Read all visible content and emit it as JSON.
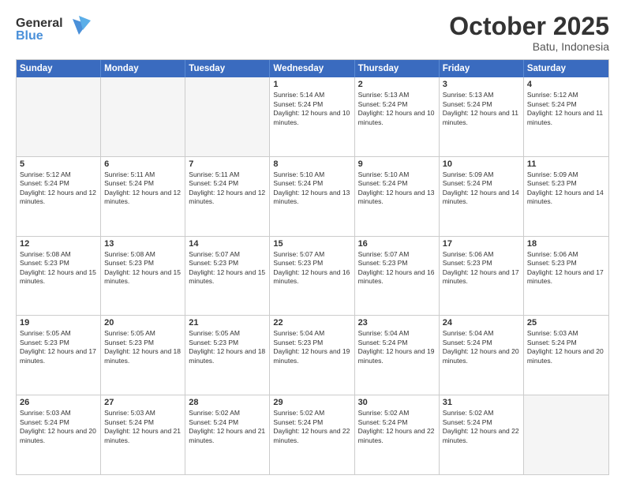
{
  "logo": {
    "line1": "General",
    "line2": "Blue"
  },
  "title": "October 2025",
  "location": "Batu, Indonesia",
  "headers": [
    "Sunday",
    "Monday",
    "Tuesday",
    "Wednesday",
    "Thursday",
    "Friday",
    "Saturday"
  ],
  "rows": [
    [
      {
        "day": "",
        "empty": true
      },
      {
        "day": "",
        "empty": true
      },
      {
        "day": "",
        "empty": true
      },
      {
        "day": "1",
        "sunrise": "5:14 AM",
        "sunset": "5:24 PM",
        "daylight": "12 hours and 10 minutes."
      },
      {
        "day": "2",
        "sunrise": "5:13 AM",
        "sunset": "5:24 PM",
        "daylight": "12 hours and 10 minutes."
      },
      {
        "day": "3",
        "sunrise": "5:13 AM",
        "sunset": "5:24 PM",
        "daylight": "12 hours and 11 minutes."
      },
      {
        "day": "4",
        "sunrise": "5:12 AM",
        "sunset": "5:24 PM",
        "daylight": "12 hours and 11 minutes."
      }
    ],
    [
      {
        "day": "5",
        "sunrise": "5:12 AM",
        "sunset": "5:24 PM",
        "daylight": "12 hours and 12 minutes."
      },
      {
        "day": "6",
        "sunrise": "5:11 AM",
        "sunset": "5:24 PM",
        "daylight": "12 hours and 12 minutes."
      },
      {
        "day": "7",
        "sunrise": "5:11 AM",
        "sunset": "5:24 PM",
        "daylight": "12 hours and 12 minutes."
      },
      {
        "day": "8",
        "sunrise": "5:10 AM",
        "sunset": "5:24 PM",
        "daylight": "12 hours and 13 minutes."
      },
      {
        "day": "9",
        "sunrise": "5:10 AM",
        "sunset": "5:24 PM",
        "daylight": "12 hours and 13 minutes."
      },
      {
        "day": "10",
        "sunrise": "5:09 AM",
        "sunset": "5:24 PM",
        "daylight": "12 hours and 14 minutes."
      },
      {
        "day": "11",
        "sunrise": "5:09 AM",
        "sunset": "5:23 PM",
        "daylight": "12 hours and 14 minutes."
      }
    ],
    [
      {
        "day": "12",
        "sunrise": "5:08 AM",
        "sunset": "5:23 PM",
        "daylight": "12 hours and 15 minutes."
      },
      {
        "day": "13",
        "sunrise": "5:08 AM",
        "sunset": "5:23 PM",
        "daylight": "12 hours and 15 minutes."
      },
      {
        "day": "14",
        "sunrise": "5:07 AM",
        "sunset": "5:23 PM",
        "daylight": "12 hours and 15 minutes."
      },
      {
        "day": "15",
        "sunrise": "5:07 AM",
        "sunset": "5:23 PM",
        "daylight": "12 hours and 16 minutes."
      },
      {
        "day": "16",
        "sunrise": "5:07 AM",
        "sunset": "5:23 PM",
        "daylight": "12 hours and 16 minutes."
      },
      {
        "day": "17",
        "sunrise": "5:06 AM",
        "sunset": "5:23 PM",
        "daylight": "12 hours and 17 minutes."
      },
      {
        "day": "18",
        "sunrise": "5:06 AM",
        "sunset": "5:23 PM",
        "daylight": "12 hours and 17 minutes."
      }
    ],
    [
      {
        "day": "19",
        "sunrise": "5:05 AM",
        "sunset": "5:23 PM",
        "daylight": "12 hours and 17 minutes."
      },
      {
        "day": "20",
        "sunrise": "5:05 AM",
        "sunset": "5:23 PM",
        "daylight": "12 hours and 18 minutes."
      },
      {
        "day": "21",
        "sunrise": "5:05 AM",
        "sunset": "5:23 PM",
        "daylight": "12 hours and 18 minutes."
      },
      {
        "day": "22",
        "sunrise": "5:04 AM",
        "sunset": "5:23 PM",
        "daylight": "12 hours and 19 minutes."
      },
      {
        "day": "23",
        "sunrise": "5:04 AM",
        "sunset": "5:24 PM",
        "daylight": "12 hours and 19 minutes."
      },
      {
        "day": "24",
        "sunrise": "5:04 AM",
        "sunset": "5:24 PM",
        "daylight": "12 hours and 20 minutes."
      },
      {
        "day": "25",
        "sunrise": "5:03 AM",
        "sunset": "5:24 PM",
        "daylight": "12 hours and 20 minutes."
      }
    ],
    [
      {
        "day": "26",
        "sunrise": "5:03 AM",
        "sunset": "5:24 PM",
        "daylight": "12 hours and 20 minutes."
      },
      {
        "day": "27",
        "sunrise": "5:03 AM",
        "sunset": "5:24 PM",
        "daylight": "12 hours and 21 minutes."
      },
      {
        "day": "28",
        "sunrise": "5:02 AM",
        "sunset": "5:24 PM",
        "daylight": "12 hours and 21 minutes."
      },
      {
        "day": "29",
        "sunrise": "5:02 AM",
        "sunset": "5:24 PM",
        "daylight": "12 hours and 22 minutes."
      },
      {
        "day": "30",
        "sunrise": "5:02 AM",
        "sunset": "5:24 PM",
        "daylight": "12 hours and 22 minutes."
      },
      {
        "day": "31",
        "sunrise": "5:02 AM",
        "sunset": "5:24 PM",
        "daylight": "12 hours and 22 minutes."
      },
      {
        "day": "",
        "empty": true
      }
    ]
  ]
}
